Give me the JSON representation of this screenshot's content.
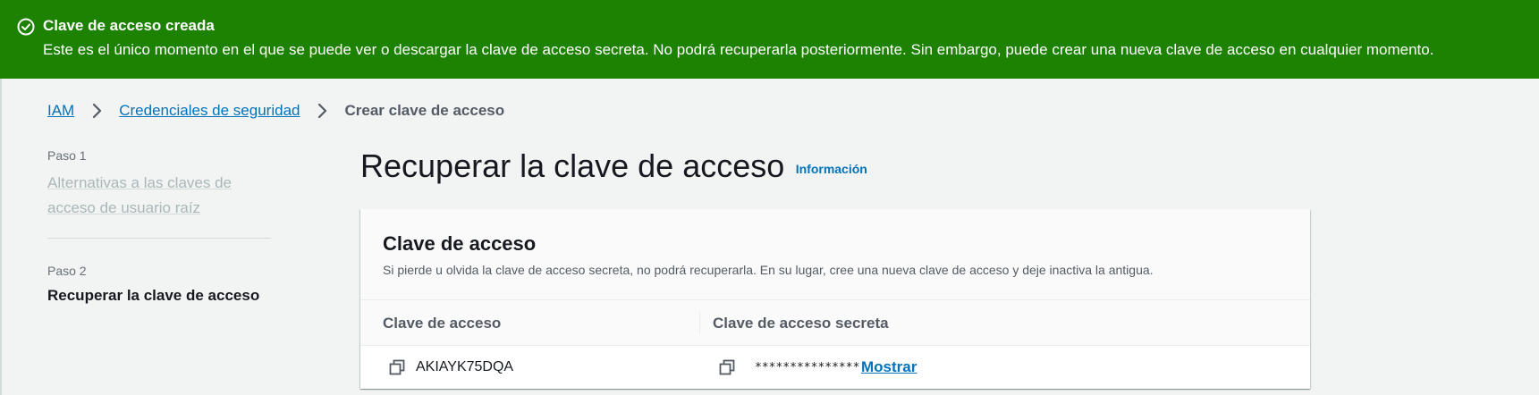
{
  "flash": {
    "title": "Clave de acceso creada",
    "message": "Este es el único momento en el que se puede ver o descargar la clave de acceso secreta. No podrá recuperarla posteriormente. Sin embargo, puede crear una nueva clave de acceso en cualquier momento.",
    "icon": "check-circle-icon",
    "color": "#1d8102"
  },
  "breadcrumb": {
    "items": [
      "IAM",
      "Credenciales de seguridad"
    ],
    "current": "Crear clave de acceso"
  },
  "steps": [
    {
      "label": "Paso 1",
      "title": "Alternativas a las claves de acceso de usuario raíz"
    },
    {
      "label": "Paso 2",
      "title": "Recuperar la clave de acceso"
    }
  ],
  "page": {
    "title": "Recuperar la clave de acceso",
    "info_link": "Información"
  },
  "card": {
    "title": "Clave de acceso",
    "description": "Si pierde u olvida la clave de acceso secreta, no podrá recuperarla. En su lugar, cree una nueva clave de acceso y deje inactiva la antigua.",
    "columns": [
      "Clave de acceso",
      "Clave de acceso secreta"
    ],
    "row": {
      "access_key": "AKIAYK75DQA",
      "secret_masked": "***************",
      "show_label": "Mostrar"
    }
  },
  "colors": {
    "link": "#0073bb",
    "success": "#1d8102",
    "background": "#f2f3f3"
  }
}
